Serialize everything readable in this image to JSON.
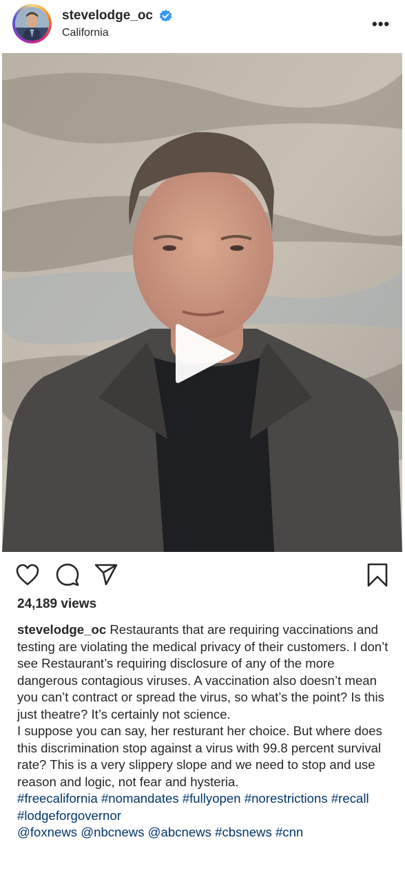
{
  "post": {
    "username": "stevelodge_oc",
    "location": "California",
    "views": "24,189 views",
    "caption_user": "stevelodge_oc",
    "caption_p1": " Restaurants that are requiring vaccinations and testing are violating the medical privacy of their customers. I don’t see Restaurant’s requiring disclosure of any of the more dangerous contagious viruses. A vaccination also doesn’t mean you can’t contract or spread the virus, so what’s the point? Is this just theatre? It’s certainly not science.",
    "caption_p2": "I suppose you can say, her resturant her choice. But where does this discrimination stop against a virus with 99.8 percent survival rate? This is a very slippery slope and we need to stop and use reason and logic, not fear and hysteria.",
    "hashtags": "#freecalifornia #nomandates #fullyopen #norestrictions #recall #lodgeforgovernor",
    "mentions": "@foxnews @nbcnews @abcnews #cbsnews #cnn"
  },
  "icons": {
    "more": "more-options-icon",
    "verified": "verified-badge-icon",
    "play": "play-icon",
    "like": "heart-icon",
    "comment": "comment-icon",
    "share": "share-icon",
    "save": "bookmark-icon"
  },
  "colors": {
    "verified": "#3897f0",
    "link": "#00376b",
    "text": "#262626"
  }
}
